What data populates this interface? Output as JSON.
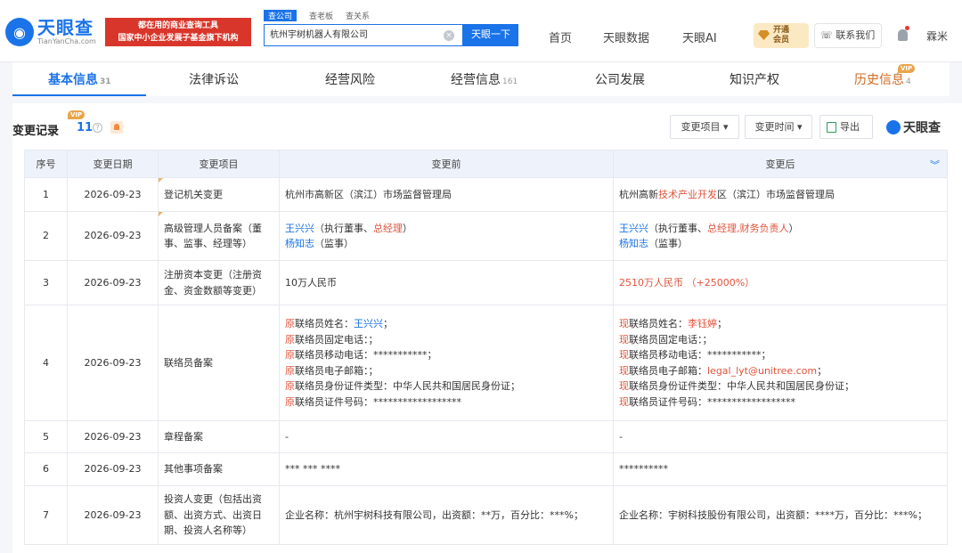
{
  "header": {
    "logo_name": "天眼查",
    "logo_url": "TianYanCha.com",
    "promo_line1": "都在用的商业查询工具",
    "promo_line2": "国家中小企业发展子基金旗下机构",
    "search_tabs": [
      "查公司",
      "查老板",
      "查关系"
    ],
    "search_value": "杭州宇树机器人有限公司",
    "search_button": "天眼一下",
    "nav": [
      "首页",
      "天眼数据",
      "天眼AI"
    ],
    "vip_line1": "开通",
    "vip_line2": "会员",
    "contact": "联系我们",
    "user": "霖米"
  },
  "tabs": [
    {
      "label": "基本信息",
      "count": "31"
    },
    {
      "label": "法律诉讼",
      "count": ""
    },
    {
      "label": "经营风险",
      "count": ""
    },
    {
      "label": "经营信息",
      "count": "161"
    },
    {
      "label": "公司发展",
      "count": ""
    },
    {
      "label": "知识产权",
      "count": ""
    },
    {
      "label": "历史信息",
      "count": "4"
    }
  ],
  "vip_tag": "VIP",
  "section": {
    "title": "变更记录",
    "count": "11",
    "filter_item": "变更项目",
    "filter_time": "变更时间",
    "export": "导出",
    "brand": "天眼查"
  },
  "table": {
    "headers": [
      "序号",
      "变更日期",
      "变更项目",
      "变更前",
      "变更后"
    ],
    "rows": [
      {
        "no": "1",
        "date": "2026-09-23",
        "item": "登记机关变更",
        "before": "杭州市高新区（滨江）市场监督管理局",
        "after_a": "杭州高新",
        "after_b": "技术产业开发",
        "after_c": "区（滨江）市场监督管理局"
      },
      {
        "no": "2",
        "date": "2026-09-23",
        "item": "高级管理人员备案（董事、监事、经理等）",
        "before_name1": "王兴兴",
        "before_role1": "（执行董事、",
        "before_role1_red": "总经理",
        "before_role1_end": "）",
        "before_name2": "杨知志",
        "before_role2": "（监事）",
        "after_name1": "王兴兴",
        "after_role1": "（执行董事、",
        "after_role1_red": "总经理,财务负责人",
        "after_role1_end": "）",
        "after_name2": "杨知志",
        "after_role2": "（监事）"
      },
      {
        "no": "3",
        "date": "2026-09-23",
        "item": "注册资本变更（注册资金、资金数额等变更）",
        "before": "10万人民币",
        "after": "2510万人民币 （+25000%）"
      },
      {
        "no": "4",
        "date": "2026-09-23",
        "item": "联络员备案",
        "before_lines": [
          {
            "p": "原",
            "t": "联络员姓名：",
            "v": "王兴兴",
            "e": "；"
          },
          {
            "p": "原",
            "t": "联络员固定电话：；",
            "v": "",
            "e": ""
          },
          {
            "p": "原",
            "t": "联络员移动电话：***********；",
            "v": "",
            "e": ""
          },
          {
            "p": "原",
            "t": "联络员电子邮箱：；",
            "v": "",
            "e": ""
          },
          {
            "p": "原",
            "t": "联络员身份证件类型：中华人民共和国居民身份证；",
            "v": "",
            "e": ""
          },
          {
            "p": "原",
            "t": "联络员证件号码：******************",
            "v": "",
            "e": ""
          }
        ],
        "after_lines": [
          {
            "p": "现",
            "t": "联络员姓名：",
            "v": "李钰婷",
            "e": "；"
          },
          {
            "p": "现",
            "t": "联络员固定电话：；",
            "v": "",
            "e": ""
          },
          {
            "p": "现",
            "t": "联络员移动电话：***********；",
            "v": "",
            "e": ""
          },
          {
            "p": "现",
            "t": "联络员电子邮箱：",
            "v": "legal_lyt@unitree.com",
            "e": "；"
          },
          {
            "p": "现",
            "t": "联络员身份证件类型：中华人民共和国居民身份证；",
            "v": "",
            "e": ""
          },
          {
            "p": "现",
            "t": "联络员证件号码：******************",
            "v": "",
            "e": ""
          }
        ]
      },
      {
        "no": "5",
        "date": "2026-09-23",
        "item": "章程备案",
        "before": "-",
        "after": "-"
      },
      {
        "no": "6",
        "date": "2026-09-23",
        "item": "其他事项备案",
        "before": "*** *** ****",
        "after": "**********"
      },
      {
        "no": "7",
        "date": "2026-09-23",
        "item": "投资人变更（包括出资额、出资方式、出资日期、投资人名称等）",
        "before": "企业名称：杭州宇树科技有限公司，出资额：**万，百分比：***%；",
        "after": "企业名称：宇树科技股份有限公司，出资额：****万，百分比：***%；"
      }
    ]
  },
  "colors": {
    "accent": "#1a73e8",
    "highlight": "#e0533b",
    "promo": "#d9362b"
  }
}
